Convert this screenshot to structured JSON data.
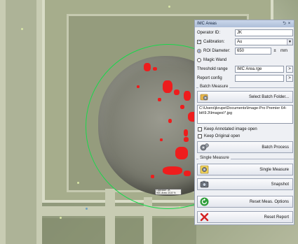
{
  "panel": {
    "title": "IMC Areas",
    "pin_glyph": "⮌",
    "close_glyph": "×",
    "operator_label": "Operator ID:",
    "operator_value": "JK",
    "calibration_label": "Calibration:",
    "calibration_checked": true,
    "calibration_value": "Au",
    "roi_label": "ROI Diameter:",
    "roi_value": "650",
    "roi_unit": "mm",
    "magic_wand_label": "Magic Wand",
    "threshold_label": "Threshold range",
    "threshold_value": "IMC Area.rge",
    "report_config_label": "Report config",
    "report_config_value": "",
    "browse_label": ">"
  },
  "batch": {
    "group_title": "Batch Measure",
    "select_folder_label": "Select Batch Folder...",
    "folder_path": "C:\\Users\\jkrupe\\Documents\\Image-Pro Premier 64-bit\\9.3\\Images\\*.jpg",
    "keep_annotated_label": "Keep Annotated image open",
    "keep_original_label": "Keep Original open",
    "batch_process_label": "Batch Process"
  },
  "single": {
    "group_title": "Single Measure",
    "single_measure_label": "Single Measure",
    "snapshot_label": "Snapshot",
    "reset_options_label": "Reset Meas. Options",
    "reset_report_label": "Reset Report"
  },
  "overlay": {
    "line1": "Operator: JK",
    "line2": "IMC Area: 20.8 %"
  },
  "colors": {
    "roi_circle": "#18d84c",
    "imc_area": "#ee1d1d",
    "panel_title_bar": "#b7c6de"
  }
}
